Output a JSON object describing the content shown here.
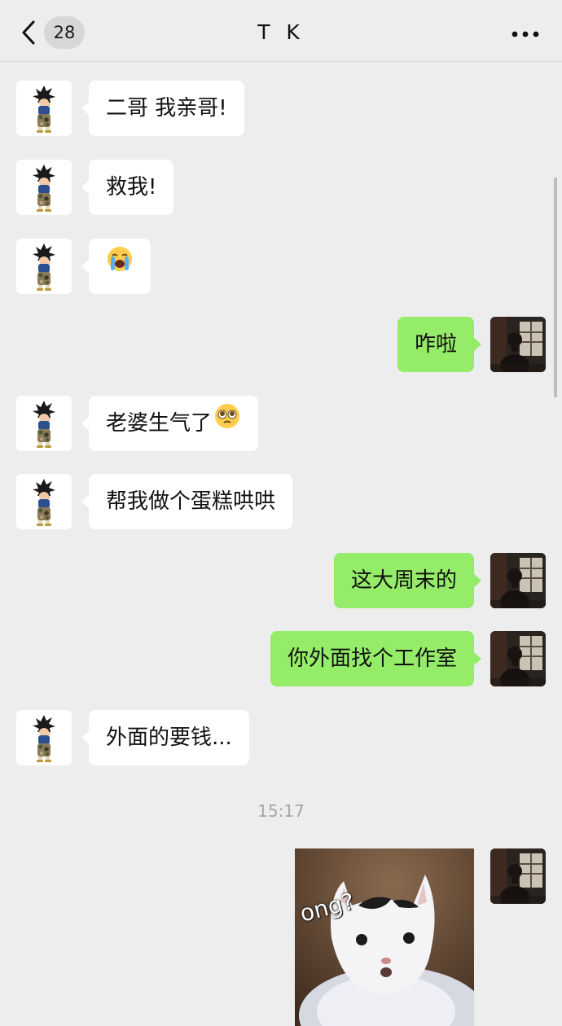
{
  "header": {
    "back_icon": "chevron-left-icon",
    "unread_count": "28",
    "title": "T K",
    "more_icon": "more-dots-icon"
  },
  "messages": [
    {
      "direction": "in",
      "text": "二哥 我亲哥!"
    },
    {
      "direction": "in",
      "text": "救我!"
    },
    {
      "direction": "in",
      "text": "",
      "emoji": "loudly-crying-face-icon"
    },
    {
      "direction": "out",
      "text": "咋啦"
    },
    {
      "direction": "in",
      "text": "老婆生气了",
      "emoji": "pleading-face-icon"
    },
    {
      "direction": "in",
      "text": "帮我做个蛋糕哄哄"
    },
    {
      "direction": "out",
      "text": "这大周末的"
    },
    {
      "direction": "out",
      "text": "你外面找个工作室"
    },
    {
      "direction": "in",
      "text": "外面的要钱..."
    }
  ],
  "timestamp": "15:17",
  "sticker": {
    "caption": "ong?",
    "subject": "confused-white-cat-sticker"
  },
  "colors": {
    "background": "#ededed",
    "incoming_bubble": "#ffffff",
    "outgoing_bubble": "#95ec69"
  }
}
